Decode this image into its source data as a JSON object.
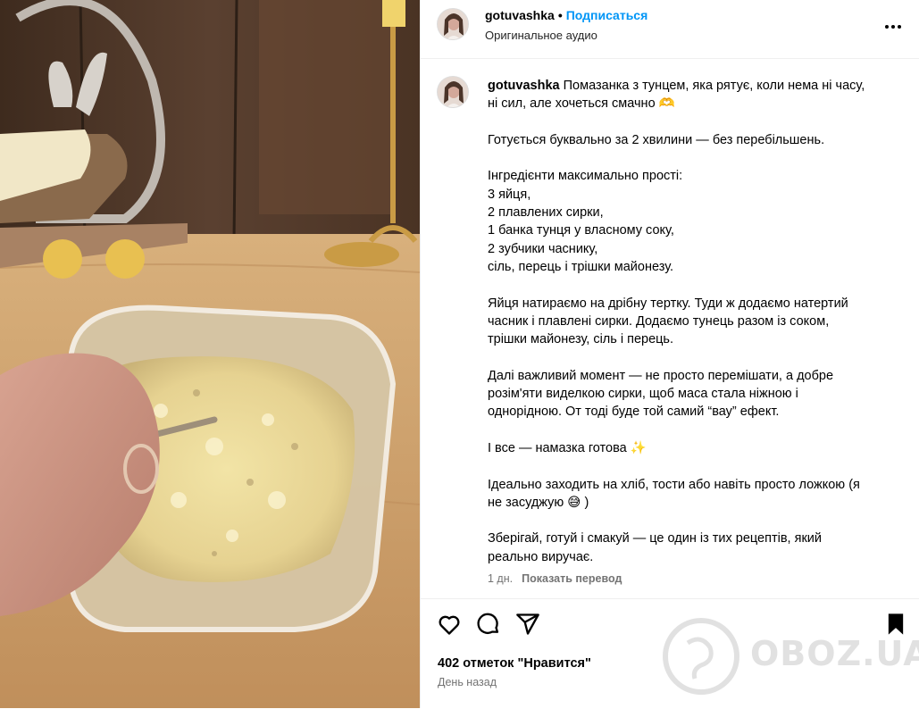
{
  "post": {
    "username": "gotuvashka",
    "separator": "•",
    "follow_label": "Подписаться",
    "audio_label": "Оригинальное аудио",
    "caption_lines": [
      "Помазанка з тунцем, яка рятує, коли нема ні часу,",
      "ні сил, але хочеться смачно 🫶",
      "",
      "Готується буквально за 2 хвилини — без перебільшень.",
      "",
      "Інгредієнти максимально прості:",
      "3 яйця,",
      "2 плавлених сирки,",
      "1 банка тунця у власному соку,",
      "2 зубчики часнику,",
      "сіль, перець і трішки майонезу.",
      "",
      "Яйця натираємо на дрібну тертку. Туди ж додаємо натертий",
      "часник і плавлені сирки. Додаємо тунець разом із соком,",
      "трішки майонезу, сіль і перець.",
      "",
      "Далі важливий момент — не просто перемішати, а добре",
      "розім'яти виделкою сирки, щоб маса стала ніжною і",
      "однорідною. От тоді буде той самий “вау” ефект.",
      "",
      "І все — намазка готова ✨",
      "",
      "Ідеально заходить на хліб, тости або навіть просто ложкою (я",
      "не засуджую 😅 )",
      "",
      "Зберігай, готуй і смакуй — це один із тих рецептів, який",
      "реально виручає."
    ],
    "caption_age": "1 дн.",
    "translate_label": "Показать перевод",
    "likes_label": "402 отметок \"Нравится\"",
    "time_ago": "День назад"
  },
  "icons": {
    "more": "more-horizontal-icon",
    "like": "heart-icon",
    "comment": "comment-icon",
    "share": "send-icon",
    "save": "bookmark-icon"
  },
  "watermark": {
    "text": "OBOZ.UA"
  },
  "colors": {
    "accent": "#0095f6",
    "secondary_text": "#737373",
    "divider": "#efefef"
  }
}
